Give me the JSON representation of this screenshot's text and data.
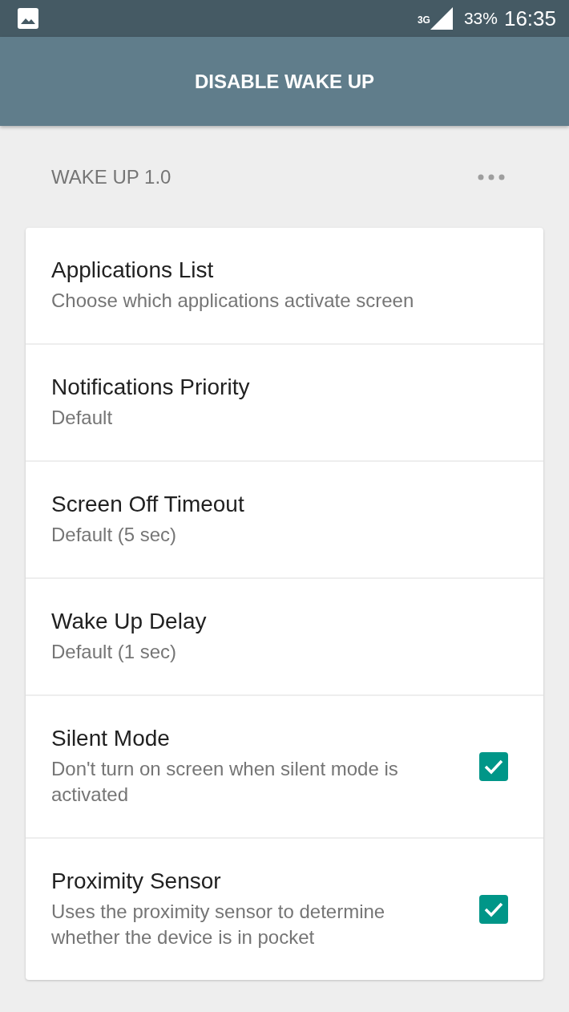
{
  "status_bar": {
    "network": "3G",
    "battery": "33%",
    "time": "16:35"
  },
  "app_bar": {
    "title": "DISABLE WAKE UP"
  },
  "section": {
    "title": "WAKE UP 1.0"
  },
  "settings": [
    {
      "kind": "link",
      "title": "Applications List",
      "summary": "Choose which applications activate screen"
    },
    {
      "kind": "link",
      "title": "Notifications Priority",
      "summary": "Default"
    },
    {
      "kind": "link",
      "title": "Screen Off Timeout",
      "summary": "Default (5 sec)"
    },
    {
      "kind": "link",
      "title": "Wake Up Delay",
      "summary": "Default (1 sec)"
    },
    {
      "kind": "checkbox",
      "title": "Silent Mode",
      "summary": "Don't turn on screen when silent mode is activated",
      "checked": true
    },
    {
      "kind": "checkbox",
      "title": "Proximity Sensor",
      "summary": "Uses the proximity sensor to determine whether the device is in pocket",
      "checked": true
    }
  ]
}
